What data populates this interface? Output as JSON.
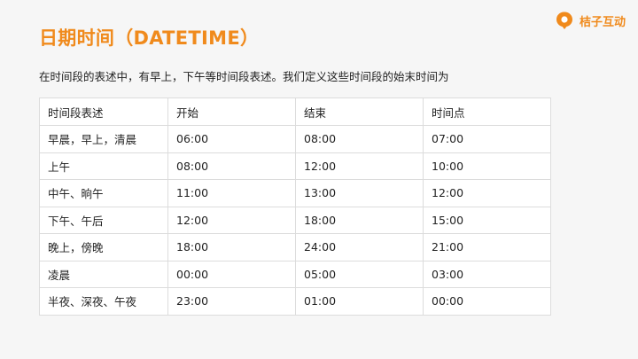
{
  "title": "日期时间（DATETIME）",
  "brand": {
    "name": "桔子互动",
    "icon": "orange-logo-icon",
    "color": "#f08a1c"
  },
  "intro": "在时间段的表述中，有早上，下午等时间段表述。我们定义这些时间段的始末时间为",
  "table": {
    "headers": [
      "时间段表述",
      "开始",
      "结束",
      "时间点"
    ],
    "rows": [
      [
        "早晨，早上，清晨",
        "06:00",
        "08:00",
        "07:00"
      ],
      [
        "上午",
        "08:00",
        "12:00",
        "10:00"
      ],
      [
        "中午、晌午",
        "11:00",
        "13:00",
        "12:00"
      ],
      [
        "下午、午后",
        "12:00",
        "18:00",
        "15:00"
      ],
      [
        "晚上，傍晚",
        "18:00",
        "24:00",
        "21:00"
      ],
      [
        "凌晨",
        "00:00",
        "05:00",
        "03:00"
      ],
      [
        "半夜、深夜、午夜",
        "23:00",
        "01:00",
        "00:00"
      ]
    ]
  }
}
